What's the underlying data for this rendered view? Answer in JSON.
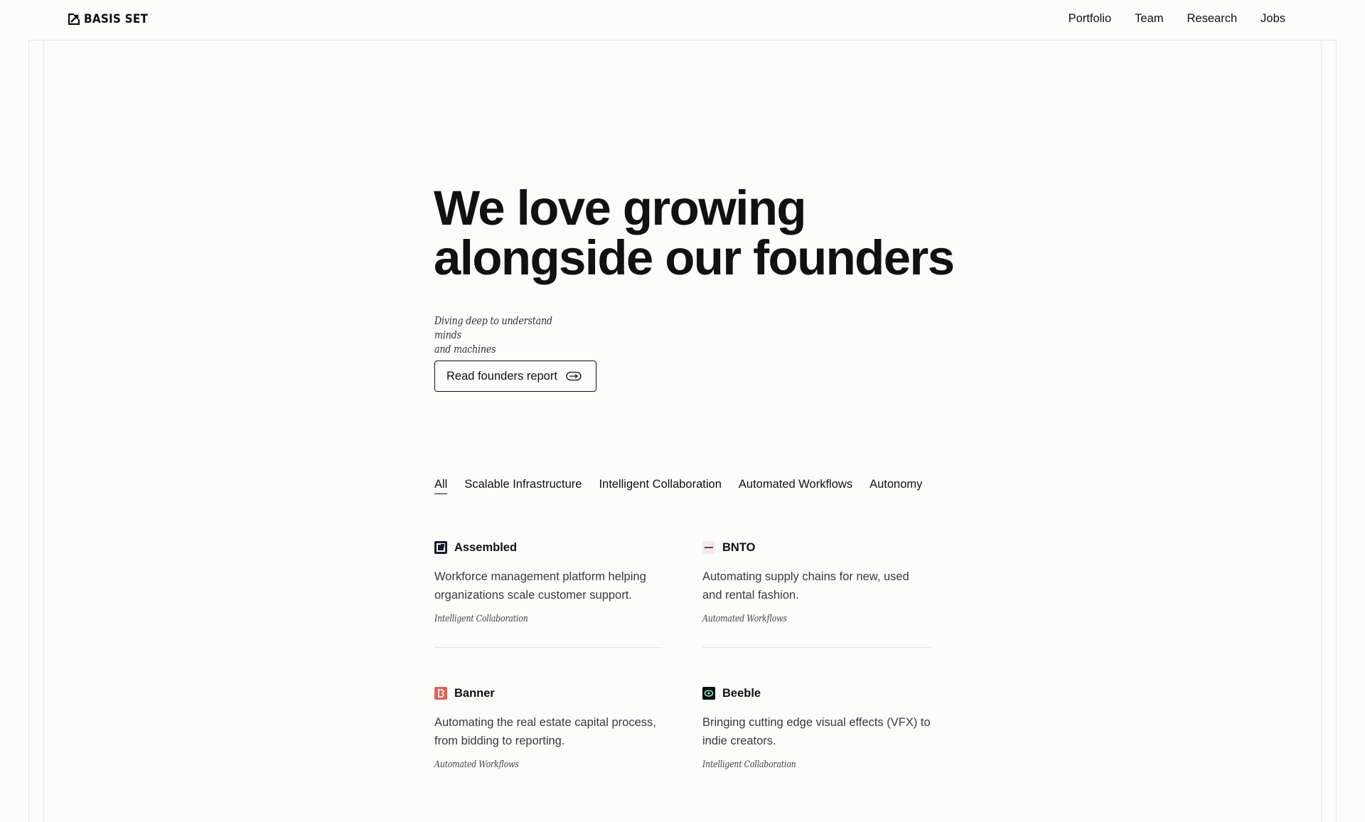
{
  "header": {
    "logo_text": "BASIS SET",
    "nav": [
      {
        "label": "Portfolio"
      },
      {
        "label": "Team"
      },
      {
        "label": "Research"
      },
      {
        "label": "Jobs"
      }
    ]
  },
  "hero": {
    "title_line1": "We love growing",
    "title_line2": "alongside our founders",
    "subtitle_line1": "Diving deep to understand minds",
    "subtitle_line2": "and machines",
    "cta_label": "Read founders report",
    "cta_icon": "arrow-pill-icon"
  },
  "tabs": [
    {
      "label": "All",
      "active": true
    },
    {
      "label": "Scalable Infrastructure",
      "active": false
    },
    {
      "label": "Intelligent Collaboration",
      "active": false
    },
    {
      "label": "Automated Workflows",
      "active": false
    },
    {
      "label": "Autonomy",
      "active": false
    }
  ],
  "companies": [
    {
      "name": "Assembled",
      "description": "Workforce management platform helping organizations scale customer support.",
      "tag": "Intelligent Collaboration",
      "icon": "assembled-logo-icon",
      "icon_color": "#1a1a2e"
    },
    {
      "name": "BNTO",
      "description": "Automating supply chains for new, used and rental fashion.",
      "tag": "Automated Workflows",
      "icon": "bnto-logo-icon",
      "icon_color": "#f3e9ea"
    },
    {
      "name": "Banner",
      "description": "Automating the real estate capital process, from bidding to reporting.",
      "tag": "Automated Workflows",
      "icon": "banner-logo-icon",
      "icon_color": "#e0635a"
    },
    {
      "name": "Beeble",
      "description": "Bringing cutting edge visual effects (VFX) to indie creators.",
      "tag": "Intelligent Collaboration",
      "icon": "beeble-logo-icon",
      "icon_color": "#0d0d0d"
    }
  ]
}
